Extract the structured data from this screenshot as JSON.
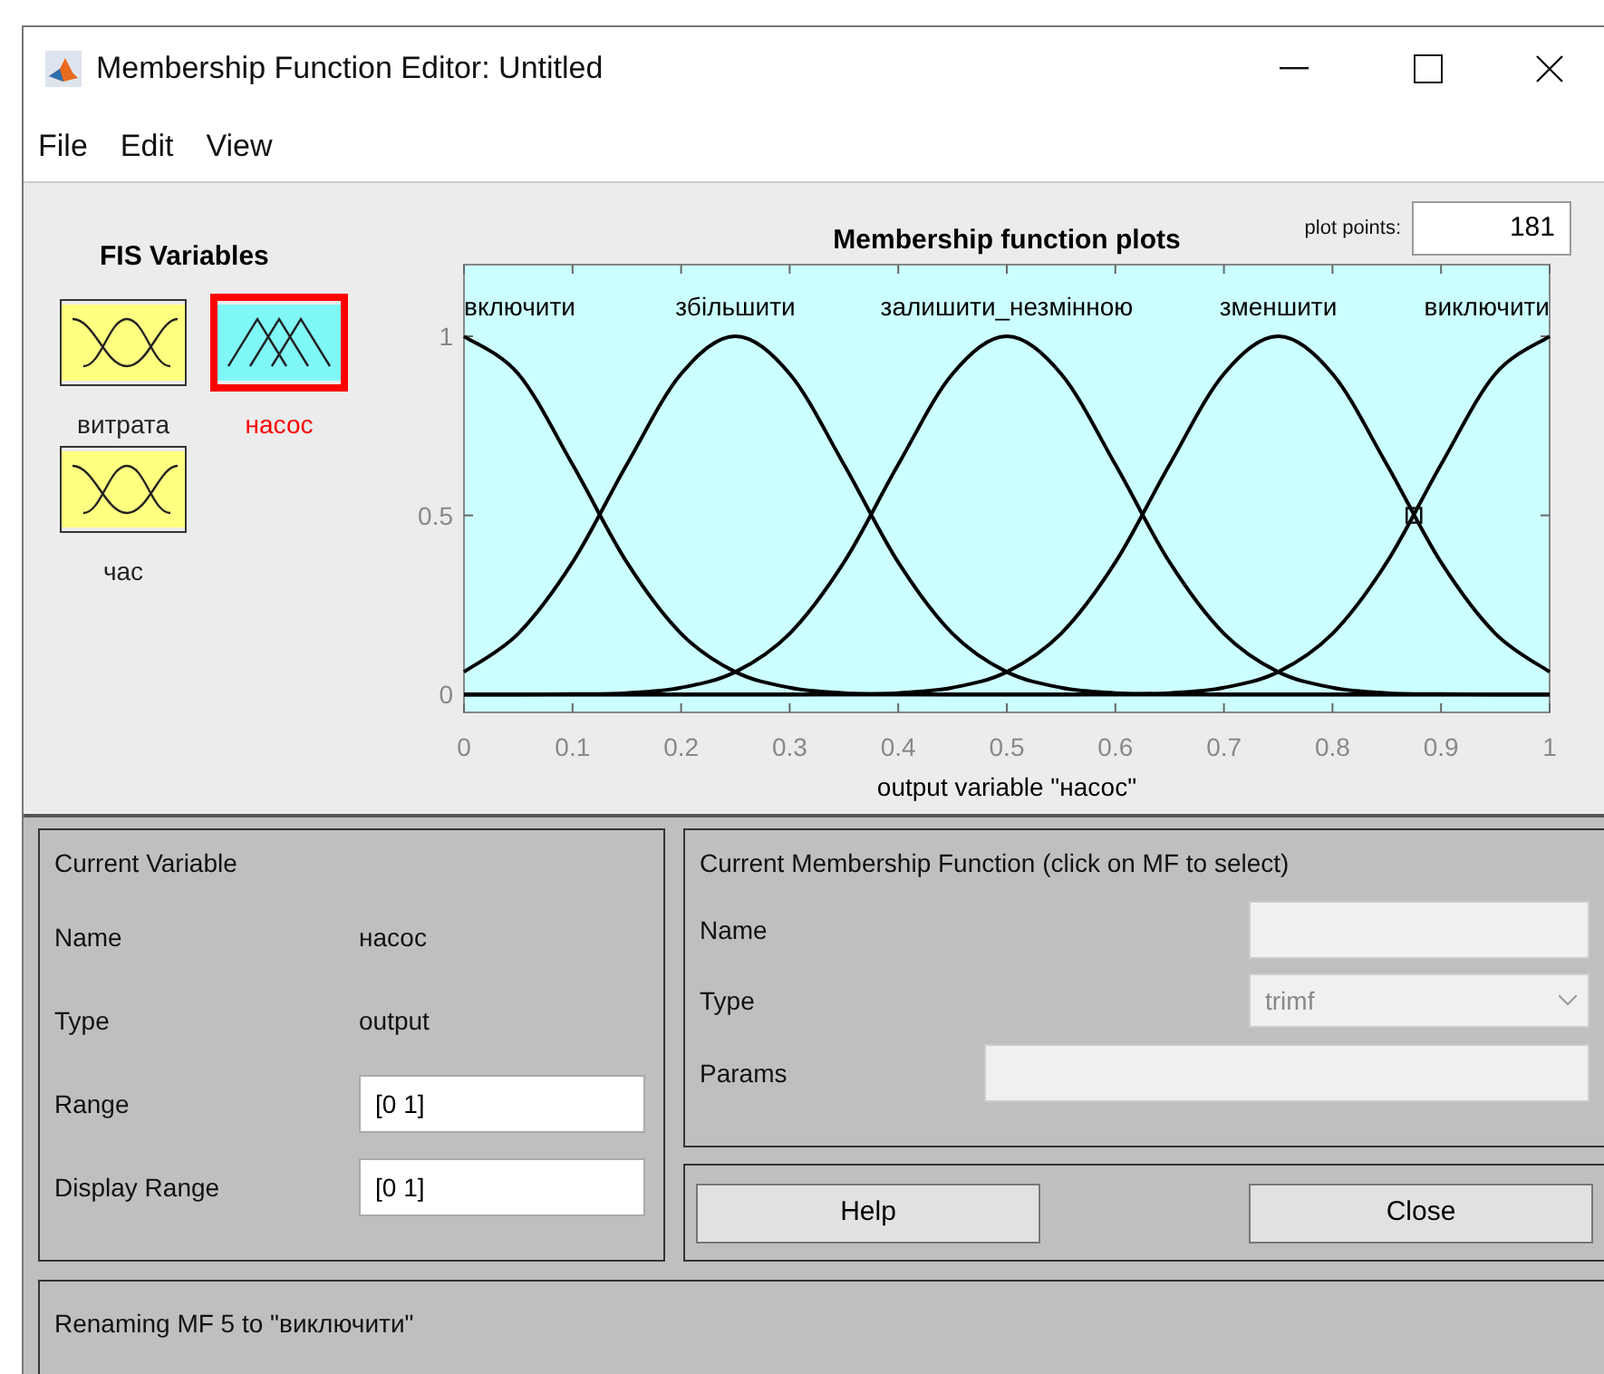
{
  "window": {
    "title": "Membership Function Editor: Untitled"
  },
  "menu": [
    "File",
    "Edit",
    "View"
  ],
  "fis_variables": {
    "title": "FIS Variables",
    "items": [
      {
        "label": "витрата",
        "kind": "input",
        "selected": false
      },
      {
        "label": "насос",
        "kind": "output",
        "selected": true
      },
      {
        "label": "час",
        "kind": "input",
        "selected": false
      }
    ]
  },
  "plot": {
    "plot_points_label": "plot points:",
    "plot_points": "181",
    "chart_data": {
      "type": "line",
      "title": "Membership function plots",
      "xlabel": "output variable \"насос\"",
      "x": [
        0,
        0.05,
        0.1,
        0.15,
        0.2,
        0.25,
        0.3,
        0.35,
        0.4,
        0.45,
        0.5,
        0.55,
        0.6,
        0.65,
        0.7,
        0.75,
        0.8,
        0.85,
        0.9,
        0.95,
        1
      ],
      "xlim": [
        0,
        1
      ],
      "ylim": [
        -0.05,
        1.2
      ],
      "xticks": [
        0,
        0.1,
        0.2,
        0.3,
        0.4,
        0.5,
        0.6,
        0.7,
        0.8,
        0.9,
        1
      ],
      "yticks": [
        0,
        0.5,
        1
      ],
      "series": [
        {
          "name": "включити",
          "color": "#000000",
          "values": [
            1,
            0.895,
            0.642,
            0.369,
            0.17,
            0.063,
            0.019,
            0.004,
            0.001,
            0,
            0,
            0,
            0,
            0,
            0,
            0,
            0,
            0,
            0,
            0,
            0
          ]
        },
        {
          "name": "збільшити",
          "color": "#000000",
          "values": [
            0.063,
            0.17,
            0.369,
            0.642,
            0.895,
            1,
            0.895,
            0.642,
            0.369,
            0.17,
            0.063,
            0.019,
            0.004,
            0.001,
            0,
            0,
            0,
            0,
            0,
            0,
            0
          ]
        },
        {
          "name": "залишити_незмінною",
          "color": "#000000",
          "values": [
            0,
            0,
            0.001,
            0.004,
            0.019,
            0.063,
            0.17,
            0.369,
            0.642,
            0.895,
            1,
            0.895,
            0.642,
            0.369,
            0.17,
            0.063,
            0.019,
            0.004,
            0.001,
            0,
            0
          ]
        },
        {
          "name": "зменшити",
          "color": "#000000",
          "values": [
            0,
            0,
            0,
            0,
            0,
            0,
            0,
            0.001,
            0.004,
            0.019,
            0.063,
            0.17,
            0.369,
            0.642,
            0.895,
            1,
            0.895,
            0.642,
            0.369,
            0.17,
            0.063
          ]
        },
        {
          "name": "виключити",
          "color": "#000000",
          "values": [
            0,
            0,
            0,
            0,
            0,
            0,
            0,
            0,
            0,
            0,
            0,
            0,
            0.001,
            0.004,
            0.019,
            0.063,
            0.17,
            0.369,
            0.642,
            0.895,
            1
          ]
        }
      ]
    }
  },
  "current_variable": {
    "title": "Current Variable",
    "name_label": "Name",
    "name": "насос",
    "type_label": "Type",
    "type": "output",
    "range_label": "Range",
    "range": "[0 1]",
    "display_range_label": "Display Range",
    "display_range": "[0 1]"
  },
  "current_mf": {
    "title": "Current Membership Function (click on MF to select)",
    "name_label": "Name",
    "type_label": "Type",
    "type": "trimf",
    "params_label": "Params"
  },
  "buttons": [
    "Help",
    "Close"
  ],
  "status": "Renaming MF 5 to \"виключити\""
}
